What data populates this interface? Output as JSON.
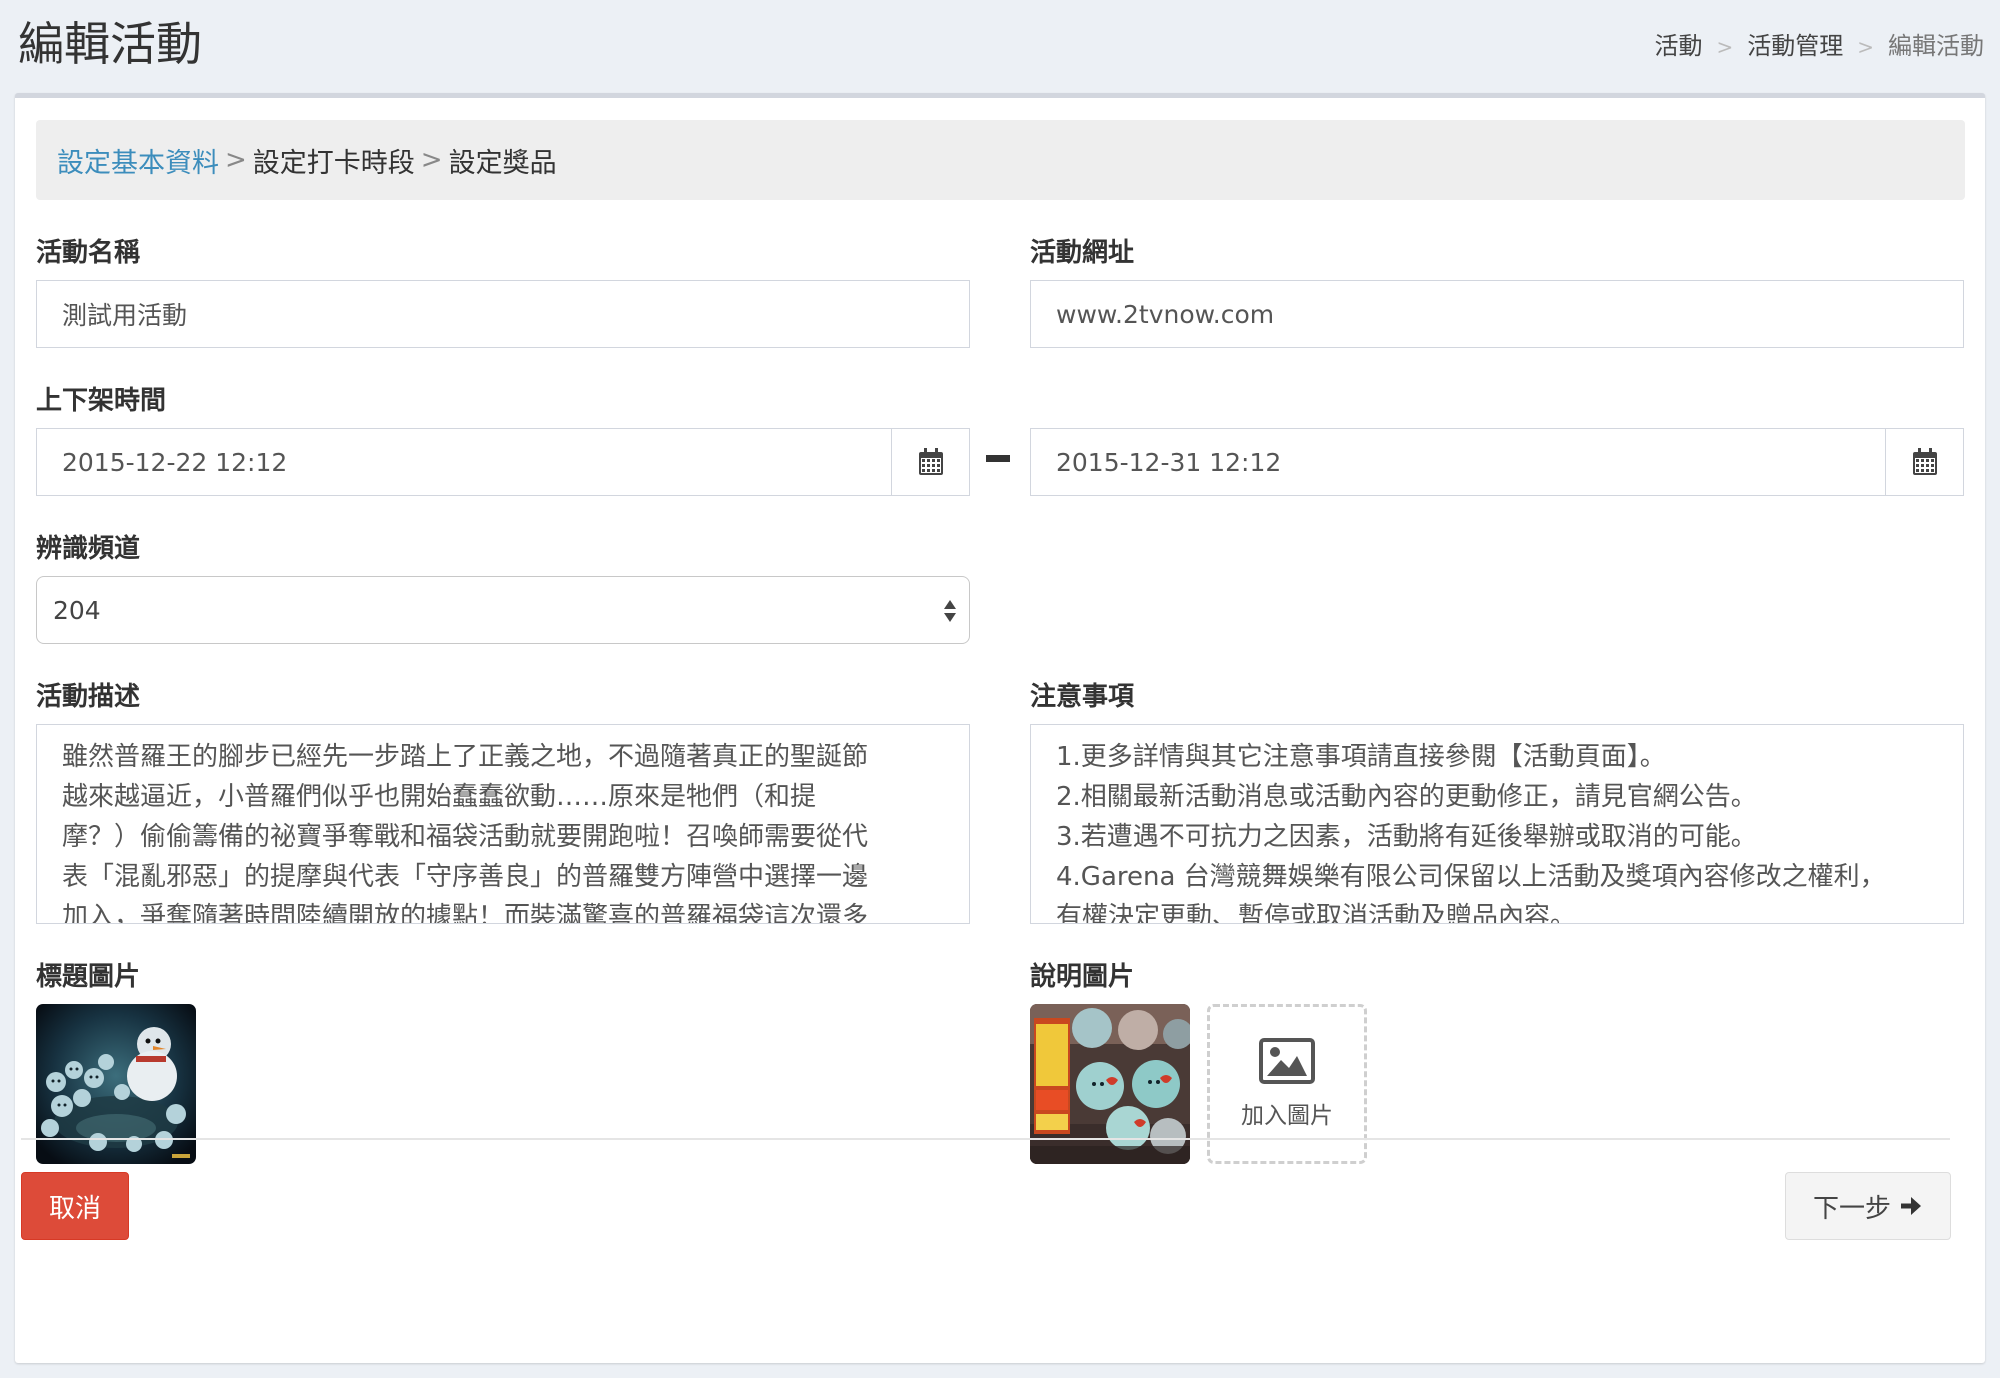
{
  "page": {
    "title": "編輯活動",
    "breadcrumb": [
      "活動",
      "活動管理",
      "編輯活動"
    ]
  },
  "steps": {
    "items": [
      "設定基本資料",
      "設定打卡時段",
      "設定獎品"
    ],
    "separator": ">"
  },
  "form": {
    "name_label": "活動名稱",
    "name_value": "測試用活動",
    "url_label": "活動網址",
    "url_value": "www.2tvnow.com",
    "time_label": "上下架時間",
    "start_value": "2015-12-22 12:12",
    "end_value": "2015-12-31 12:12",
    "channel_label": "辨識頻道",
    "channel_value": "204",
    "desc_label": "活動描述",
    "desc_lines": [
      "雖然普羅王的腳步已經先一步踏上了正義之地，不過隨著真正的聖誕節",
      "越來越逼近，小普羅們似乎也開始蠢蠢欲動……原來是牠們（和提",
      "摩？）偷偷籌備的祕寶爭奪戰和福袋活動就要開跑啦！召喚師需要從代",
      "表「混亂邪惡」的提摩與代表「守序善良」的普羅雙方陣營中選擇一邊",
      "加入，爭奪隨著時間陸續開放的據點！而裝滿驚喜的普羅福袋這次還多"
    ],
    "notes_label": "注意事項",
    "notes_lines": [
      "1.更多詳情與其它注意事項請直接參閱【活動頁面】。",
      "2.相關最新活動消息或活動內容的更動修正，請見官網公告。",
      "3.若遭遇不可抗力之因素，活動將有延後舉辦或取消的可能。",
      "4.Garena 台灣競舞娛樂有限公司保留以上活動及獎項內容修改之權利，",
      "有權決定更動、暫停或取消活動及贈品內容。"
    ],
    "title_image_label": "標題圖片",
    "desc_image_label": "說明圖片",
    "add_image_label": "加入圖片"
  },
  "actions": {
    "cancel_label": "取消",
    "next_label": "下一步"
  },
  "colors": {
    "accent": "#3c8dbc",
    "danger": "#dd4b39",
    "page_bg": "#ecf0f5"
  },
  "icons": {
    "date": "calendar-icon",
    "select": "select-updown-icon",
    "add": "image-icon",
    "next": "arrow-right-icon"
  }
}
